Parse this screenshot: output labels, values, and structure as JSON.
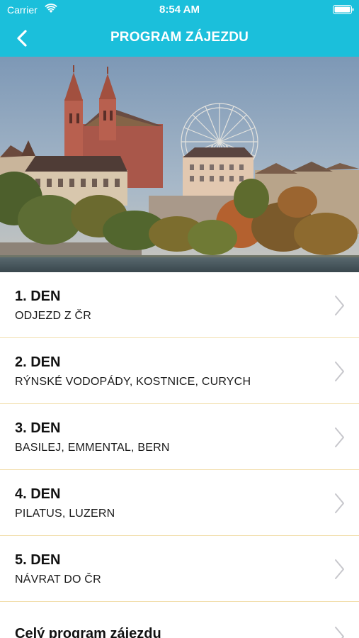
{
  "status_bar": {
    "carrier": "Carrier",
    "time": "8:54 AM",
    "wifi_icon": "wifi-icon",
    "battery_icon": "battery-icon"
  },
  "nav": {
    "title": "PROGRAM ZÁJEZDU",
    "back_icon": "chevron-left-icon",
    "bar_color": "#1bbfdb"
  },
  "hero": {
    "image": "Basel cathedral and Ferris wheel by the river"
  },
  "items": [
    {
      "day": "1. DEN",
      "desc": "ODJEZD Z ČR"
    },
    {
      "day": "2. DEN",
      "desc": "RÝNSKÉ VODOPÁDY, KOSTNICE, CURYCH"
    },
    {
      "day": "3. DEN",
      "desc": "BASILEJ, EMMENTAL, BERN"
    },
    {
      "day": "4. DEN",
      "desc": "PILATUS, LUZERN"
    },
    {
      "day": "5. DEN",
      "desc": "NÁVRAT DO ČR"
    },
    {
      "day": "Celý program zájezdu",
      "desc": ""
    }
  ],
  "separator_color": "#f2dfae"
}
